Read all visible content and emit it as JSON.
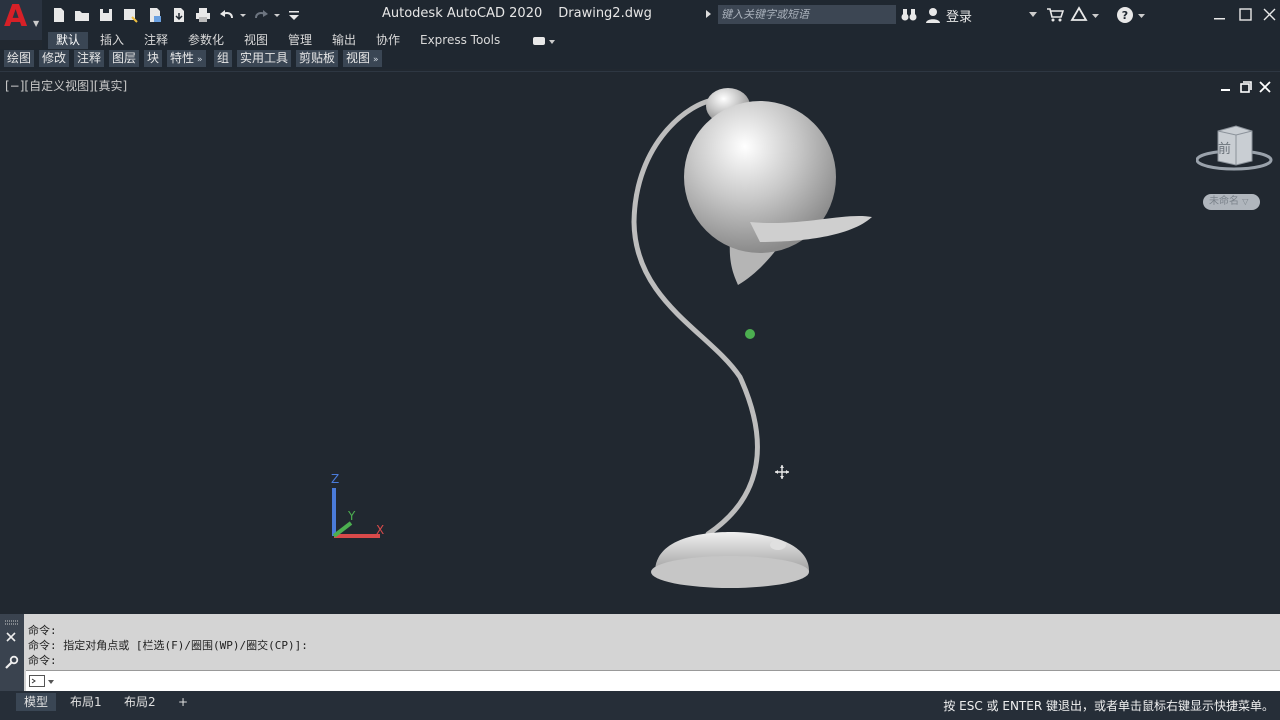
{
  "app": {
    "title_app": "Autodesk AutoCAD 2020",
    "title_file": "Drawing2.dwg",
    "logo_letter": "A",
    "search_placeholder": "键入关键字或短语",
    "login_label": "登录"
  },
  "ribbon_tabs": [
    {
      "label": "默认",
      "active": true
    },
    {
      "label": "插入"
    },
    {
      "label": "注释"
    },
    {
      "label": "参数化"
    },
    {
      "label": "视图"
    },
    {
      "label": "管理"
    },
    {
      "label": "输出"
    },
    {
      "label": "协作"
    },
    {
      "label": "Express Tools"
    }
  ],
  "panels": [
    {
      "label": "绘图"
    },
    {
      "label": "修改"
    },
    {
      "label": "注释"
    },
    {
      "label": "图层"
    },
    {
      "label": "块"
    },
    {
      "label": "特性",
      "more": "»"
    },
    {
      "label": "组"
    },
    {
      "label": "实用工具"
    },
    {
      "label": "剪贴板"
    },
    {
      "label": "视图",
      "more": "»"
    }
  ],
  "viewport": {
    "label": "[−][自定义视图][真实]",
    "viewcube_face": "前",
    "wcs_label": "未命名",
    "ucs_axes": {
      "x": "X",
      "y": "Y",
      "z": "Z"
    }
  },
  "command": {
    "history": [
      "命令:",
      "命令: 指定对角点或 [栏选(F)/圈围(WP)/圈交(CP)]:",
      "命令:"
    ],
    "input_value": ""
  },
  "layout_tabs": [
    {
      "label": "模型",
      "active": true
    },
    {
      "label": "布局1"
    },
    {
      "label": "布局2"
    },
    {
      "label": "+"
    }
  ],
  "status_message": "按 ESC 或 ENTER 键退出，或者单击鼠标右键显示快捷菜单。",
  "colors": {
    "background": "#212830",
    "accent_red": "#d72027",
    "ucs_x": "#d94a4a",
    "ucs_y": "#4caf50",
    "ucs_z": "#4a7bd9"
  }
}
